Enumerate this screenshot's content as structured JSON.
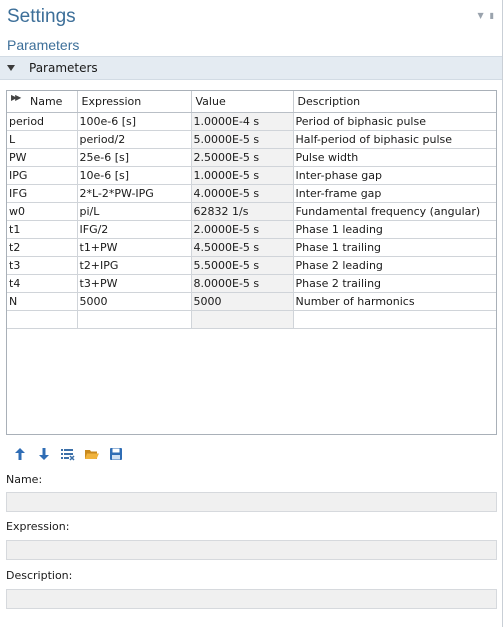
{
  "window": {
    "title": "Settings",
    "subtitle": "Parameters"
  },
  "section": {
    "label": "Parameters",
    "expanded": true
  },
  "table": {
    "headers": {
      "name": "Name",
      "expression": "Expression",
      "value": "Value",
      "description": "Description"
    },
    "rows": [
      {
        "name": "period",
        "expression": "100e-6 [s]",
        "value": "1.0000E-4 s",
        "description": "Period of biphasic pulse"
      },
      {
        "name": "L",
        "expression": "period/2",
        "value": "5.0000E-5 s",
        "description": "Half-period of biphasic pulse"
      },
      {
        "name": "PW",
        "expression": "25e-6 [s]",
        "value": "2.5000E-5 s",
        "description": "Pulse width"
      },
      {
        "name": "IPG",
        "expression": "10e-6 [s]",
        "value": "1.0000E-5 s",
        "description": "Inter-phase gap"
      },
      {
        "name": "IFG",
        "expression": "2*L-2*PW-IPG",
        "value": "4.0000E-5 s",
        "description": "Inter-frame gap"
      },
      {
        "name": "w0",
        "expression": "pi/L",
        "value": "62832 1/s",
        "description": "Fundamental frequency (angular)"
      },
      {
        "name": "t1",
        "expression": "IFG/2",
        "value": "2.0000E-5 s",
        "description": "Phase 1 leading"
      },
      {
        "name": "t2",
        "expression": "t1+PW",
        "value": "4.5000E-5 s",
        "description": "Phase 1 trailing"
      },
      {
        "name": "t3",
        "expression": "t2+IPG",
        "value": "5.5000E-5 s",
        "description": "Phase 2 leading"
      },
      {
        "name": "t4",
        "expression": "t3+PW",
        "value": "8.0000E-5 s",
        "description": "Phase 2 trailing"
      },
      {
        "name": "N",
        "expression": "5000",
        "value": "5000",
        "description": "Number of harmonics"
      },
      {
        "name": "",
        "expression": "",
        "value": "",
        "description": ""
      }
    ]
  },
  "toolbar": {
    "buttons": [
      {
        "icon": "arrow-up-icon",
        "color": "#2f6db5"
      },
      {
        "icon": "arrow-down-icon",
        "color": "#2f6db5"
      },
      {
        "icon": "clear-table-icon",
        "color": "#3b6fa8"
      },
      {
        "icon": "open-folder-icon",
        "color": "#e0a030"
      },
      {
        "icon": "save-icon",
        "color": "#2f6db5"
      }
    ]
  },
  "fields": {
    "name_label": "Name:",
    "name_value": "",
    "expression_label": "Expression:",
    "expression_value": "",
    "description_label": "Description:",
    "description_value": ""
  },
  "colors": {
    "title": "#3d6f99",
    "section_bg": "#e4ebf2",
    "value_cell_bg": "#f2f2f2"
  }
}
